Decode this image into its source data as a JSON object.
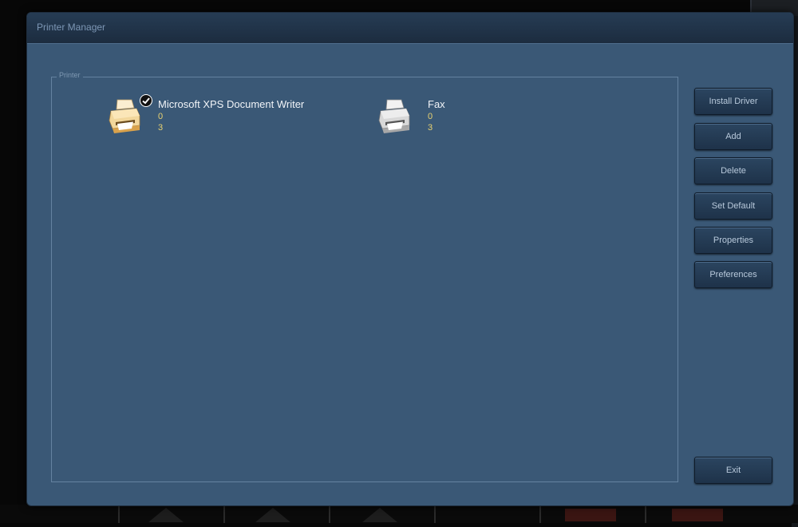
{
  "dialog": {
    "title": "Printer Manager",
    "group_label": "Printer"
  },
  "printers": [
    {
      "name": "Microsoft XPS Document Writer",
      "jobs": "0",
      "status": "3",
      "is_default": true,
      "icon": "printer-icon-yellow"
    },
    {
      "name": "Fax",
      "jobs": "0",
      "status": "3",
      "is_default": false,
      "icon": "fax-printer-icon-gray"
    }
  ],
  "buttons": {
    "install_driver": "Install Driver",
    "add": "Add",
    "delete": "Delete",
    "set_default": "Set Default",
    "properties": "Properties",
    "preferences": "Preferences",
    "exit": "Exit"
  },
  "colors": {
    "dialog_bg": "#3a5876",
    "titlebar": "#1f3147",
    "button": "#24394f",
    "job_text": "#e8d270"
  }
}
